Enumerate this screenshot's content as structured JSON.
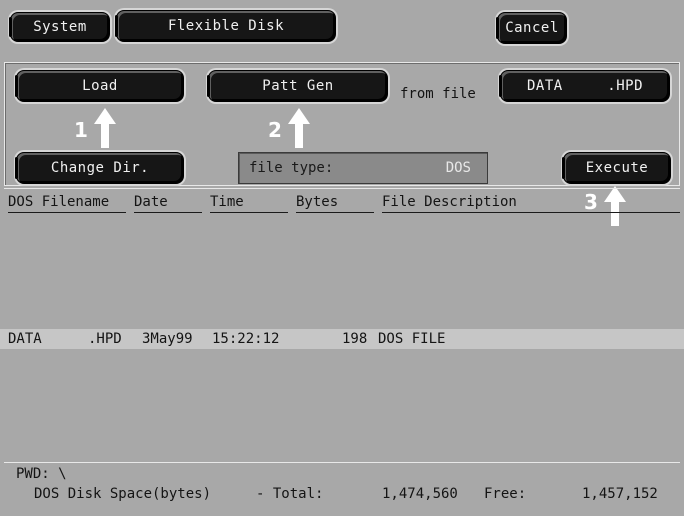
{
  "toolbar": {
    "system_label": "System",
    "flexible_disk_label": "Flexible Disk",
    "cancel_label": "Cancel"
  },
  "panel": {
    "load_label": "Load",
    "patt_gen_label": "Patt Gen",
    "from_file_label": "from file",
    "file_name": "DATA",
    "file_ext": ".HPD",
    "change_dir_label": "Change Dir.",
    "file_type_label": "file type:",
    "file_type_value": "DOS",
    "execute_label": "Execute"
  },
  "annotations": {
    "step1": "1",
    "step2": "2",
    "step3": "3"
  },
  "table": {
    "columns": [
      "DOS Filename",
      "Date",
      "Time",
      "Bytes",
      "File Description"
    ],
    "rows": [
      {
        "filename": "DATA",
        "ext": ".HPD",
        "date": "3May99",
        "time": "15:22:12",
        "bytes": "198",
        "description": "DOS FILE"
      }
    ]
  },
  "status": {
    "pwd": "PWD: \\",
    "disk_space_label": "DOS Disk Space(bytes)",
    "total_label": "- Total:",
    "total_value": "1,474,560",
    "free_label": "Free:",
    "free_value": "1,457,152"
  }
}
